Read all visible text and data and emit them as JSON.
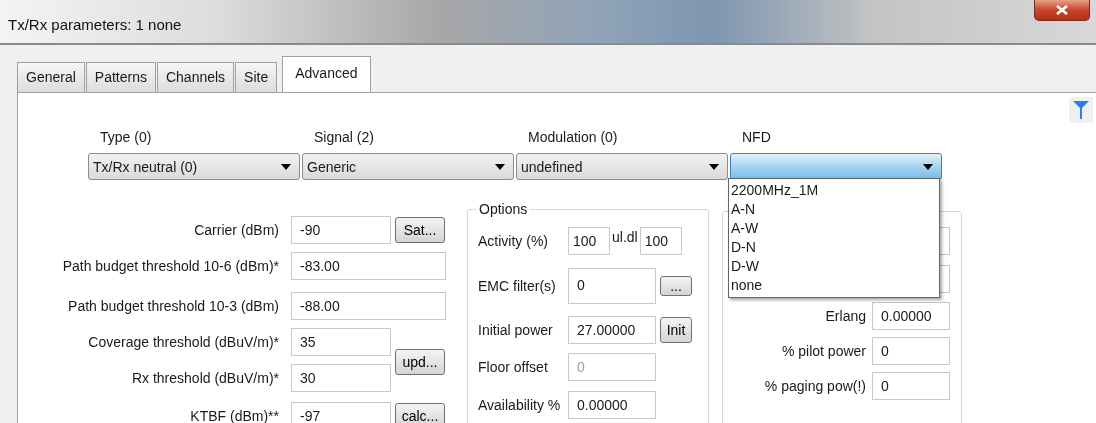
{
  "window": {
    "title": "Tx/Rx parameters: 1 none"
  },
  "tabs": [
    {
      "label": "General",
      "selected": false
    },
    {
      "label": "Patterns",
      "selected": false
    },
    {
      "label": "Channels",
      "selected": false
    },
    {
      "label": "Site",
      "selected": false
    },
    {
      "label": "Advanced",
      "selected": true
    }
  ],
  "selectors": [
    {
      "label": "Type (0)",
      "value": "Tx/Rx neutral (0)",
      "expanded": false
    },
    {
      "label": "Signal (2)",
      "value": "Generic",
      "expanded": false
    },
    {
      "label": "Modulation (0)",
      "value": "undefined",
      "expanded": false
    },
    {
      "label": "NFD",
      "expanded": true,
      "options": [
        "2200MHz_1M",
        "A-N",
        "A-W",
        "D-N",
        "D-W",
        "none"
      ]
    }
  ],
  "left_fields": [
    {
      "kind": "short",
      "label": "Carrier (dBm)",
      "value": "-90",
      "button": "Sat..."
    },
    {
      "kind": "wide",
      "label": "Path budget threshold 10-6 (dBm)*",
      "value": "-83.00"
    },
    {
      "kind": "wide",
      "label": "Path budget threshold 10-3 (dBm)",
      "value": "-88.00"
    },
    {
      "kind": "pair_start",
      "label": "Coverage threshold (dBuV/m)*",
      "value": "35",
      "button": "upd..."
    },
    {
      "kind": "pair_end",
      "label": "Rx threshold (dBuV/m)*",
      "value": "30"
    },
    {
      "kind": "short",
      "label": "KTBF (dBm)**",
      "value": "-97",
      "button": "calc..."
    }
  ],
  "options_group": {
    "legend": "Options",
    "rows": [
      {
        "kind": "pair",
        "label": "Activity (%)",
        "value": "100",
        "mid_label": "ul.dl",
        "value2": "100",
        "disabled": false
      },
      {
        "kind": "list",
        "label": "EMC filter(s)",
        "value": "0",
        "button": "...",
        "disabled": false
      },
      {
        "kind": "button",
        "label": "Initial power",
        "value": "27.00000",
        "button": "Init",
        "disabled": false
      },
      {
        "kind": "plain",
        "label": "Floor offset",
        "value": "0",
        "disabled": true
      },
      {
        "kind": "plain",
        "label": "Availability %",
        "value": "0.00000",
        "disabled": false
      }
    ]
  },
  "right_group": {
    "rows": [
      {
        "kind": "covered"
      },
      {
        "kind": "covered"
      },
      {
        "kind": "field",
        "label": "Erlang",
        "value": "0.00000"
      },
      {
        "kind": "field",
        "label": "% pilot power",
        "value": "0"
      },
      {
        "kind": "field",
        "label": "% paging pow(!)",
        "value": "0"
      }
    ]
  }
}
